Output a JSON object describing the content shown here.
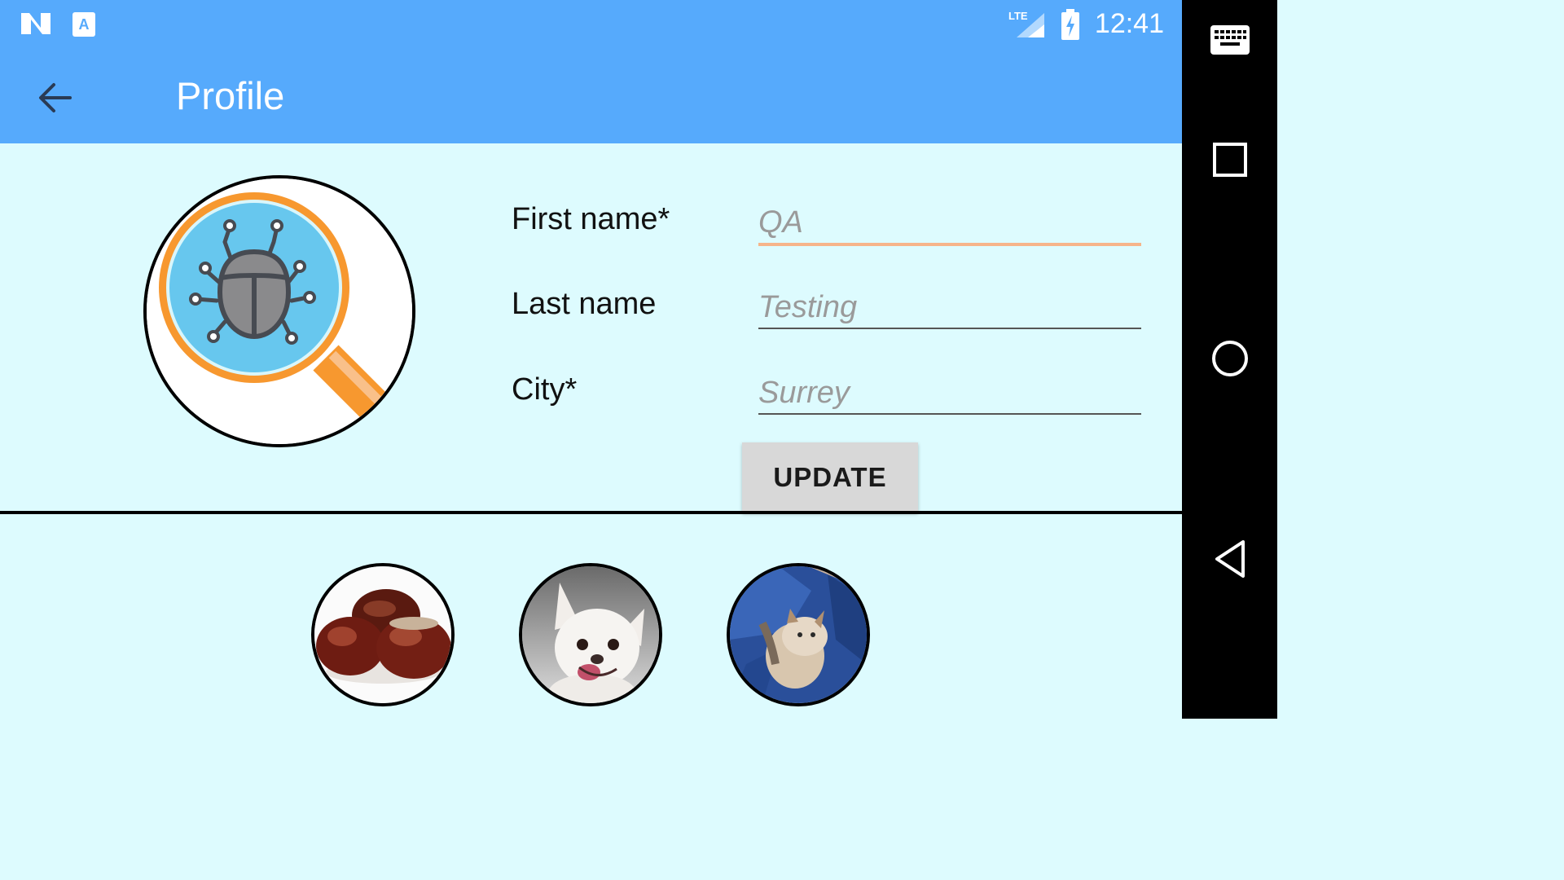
{
  "status_bar": {
    "time": "12:41",
    "icons": [
      "n-logo-icon",
      "a-keyboard-icon",
      "lte-signal-icon",
      "battery-charging-icon"
    ]
  },
  "app_bar": {
    "title": "Profile",
    "back_icon": "arrow-back-icon"
  },
  "profile": {
    "avatar_icon": "bug-magnifier-icon",
    "fields": [
      {
        "label": "First name*",
        "placeholder": "QA"
      },
      {
        "label": "Last name",
        "placeholder": "Testing"
      },
      {
        "label": "City*",
        "placeholder": "Surrey"
      }
    ],
    "update_label": "UPDATE"
  },
  "gallery": {
    "photos": [
      "chestnuts-photo",
      "chihuahua-photo",
      "cat-photo"
    ]
  },
  "nav_bar": {
    "icons": [
      "keyboard-icon",
      "recents-square-icon",
      "home-circle-icon",
      "back-triangle-icon"
    ]
  },
  "colors": {
    "primary": "#56aafc",
    "background": "#ddfbfe",
    "accent_underline": "#f6b48a",
    "magnifier_orange": "#f7982f",
    "lens_blue": "#67c7ee"
  }
}
